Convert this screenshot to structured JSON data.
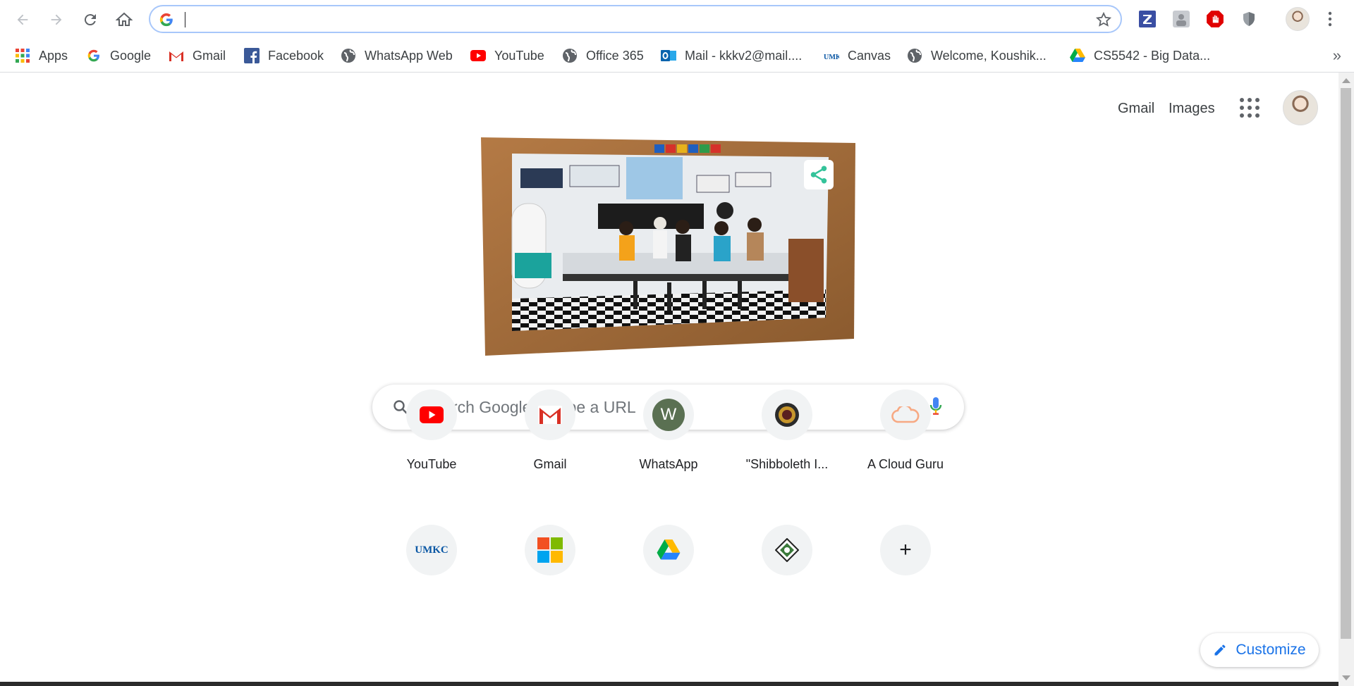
{
  "browser": {
    "omnibox_value": "",
    "omnibox_placeholder": ""
  },
  "bookmarks": [
    {
      "label": "Apps",
      "icon": "apps-grid-icon"
    },
    {
      "label": "Google",
      "icon": "google-icon"
    },
    {
      "label": "Gmail",
      "icon": "gmail-icon"
    },
    {
      "label": "Facebook",
      "icon": "facebook-icon"
    },
    {
      "label": "WhatsApp Web",
      "icon": "globe-icon"
    },
    {
      "label": "YouTube",
      "icon": "youtube-icon"
    },
    {
      "label": "Office 365",
      "icon": "globe-icon"
    },
    {
      "label": "Mail - kkkv2@mail....",
      "icon": "outlook-icon"
    },
    {
      "label": "Canvas",
      "icon": "umkc-icon"
    },
    {
      "label": "Welcome, Koushik...",
      "icon": "globe-icon"
    },
    {
      "label": "CS5542 - Big Data...",
      "icon": "drive-icon"
    }
  ],
  "header": {
    "gmail_link": "Gmail",
    "images_link": "Images"
  },
  "search": {
    "placeholder": "Search Google or type a URL",
    "value": ""
  },
  "shortcuts": [
    {
      "label": "YouTube",
      "icon": "youtube-icon"
    },
    {
      "label": "Gmail",
      "icon": "gmail-icon"
    },
    {
      "label": "WhatsApp",
      "icon": "w-letter-icon",
      "letter": "W"
    },
    {
      "label": "\"Shibboleth I...",
      "icon": "seal-icon"
    },
    {
      "label": "A Cloud Guru",
      "icon": "cloud-icon"
    }
  ],
  "shortcuts_row2": [
    {
      "icon": "umkc-icon",
      "text": "UMKC"
    },
    {
      "icon": "microsoft-icon"
    },
    {
      "icon": "drive-icon"
    },
    {
      "icon": "badge-icon"
    },
    {
      "icon": "add-shortcut-icon",
      "text": "+"
    }
  ],
  "customize_label": "Customize",
  "colors": {
    "accent": "#1a73e8",
    "youtube_red": "#ff0000",
    "whatsapp_tile": "#5a7052",
    "omnibox_border": "#a8c7fa"
  }
}
